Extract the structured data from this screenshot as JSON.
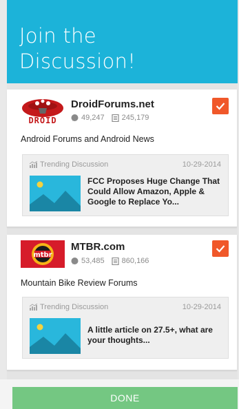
{
  "header": {
    "title": "Join the\nDiscussion!"
  },
  "forums": [
    {
      "name": "DroidForums.net",
      "members": "49,247",
      "posts": "245,179",
      "description": "Android Forums and Android News",
      "selected": true,
      "trending": {
        "label": "Trending Discussion",
        "date": "10-29-2014",
        "title": "FCC Proposes Huge Change That Could Allow Amazon, Apple & Google to Replace Yo..."
      }
    },
    {
      "name": "MTBR.com",
      "logo_text": "mtbr",
      "members": "53,485",
      "posts": "860,166",
      "description": "Mountain Bike Review Forums",
      "selected": true,
      "trending": {
        "label": "Trending Discussion",
        "date": "10-29-2014",
        "title": "A little article on 27.5+, what are your thoughts..."
      }
    }
  ],
  "footer": {
    "done_label": "DONE"
  },
  "colors": {
    "header": "#1cb3d9",
    "checkbox": "#f0582a",
    "done": "#74c782",
    "thumbnail": "#29b7dc"
  }
}
